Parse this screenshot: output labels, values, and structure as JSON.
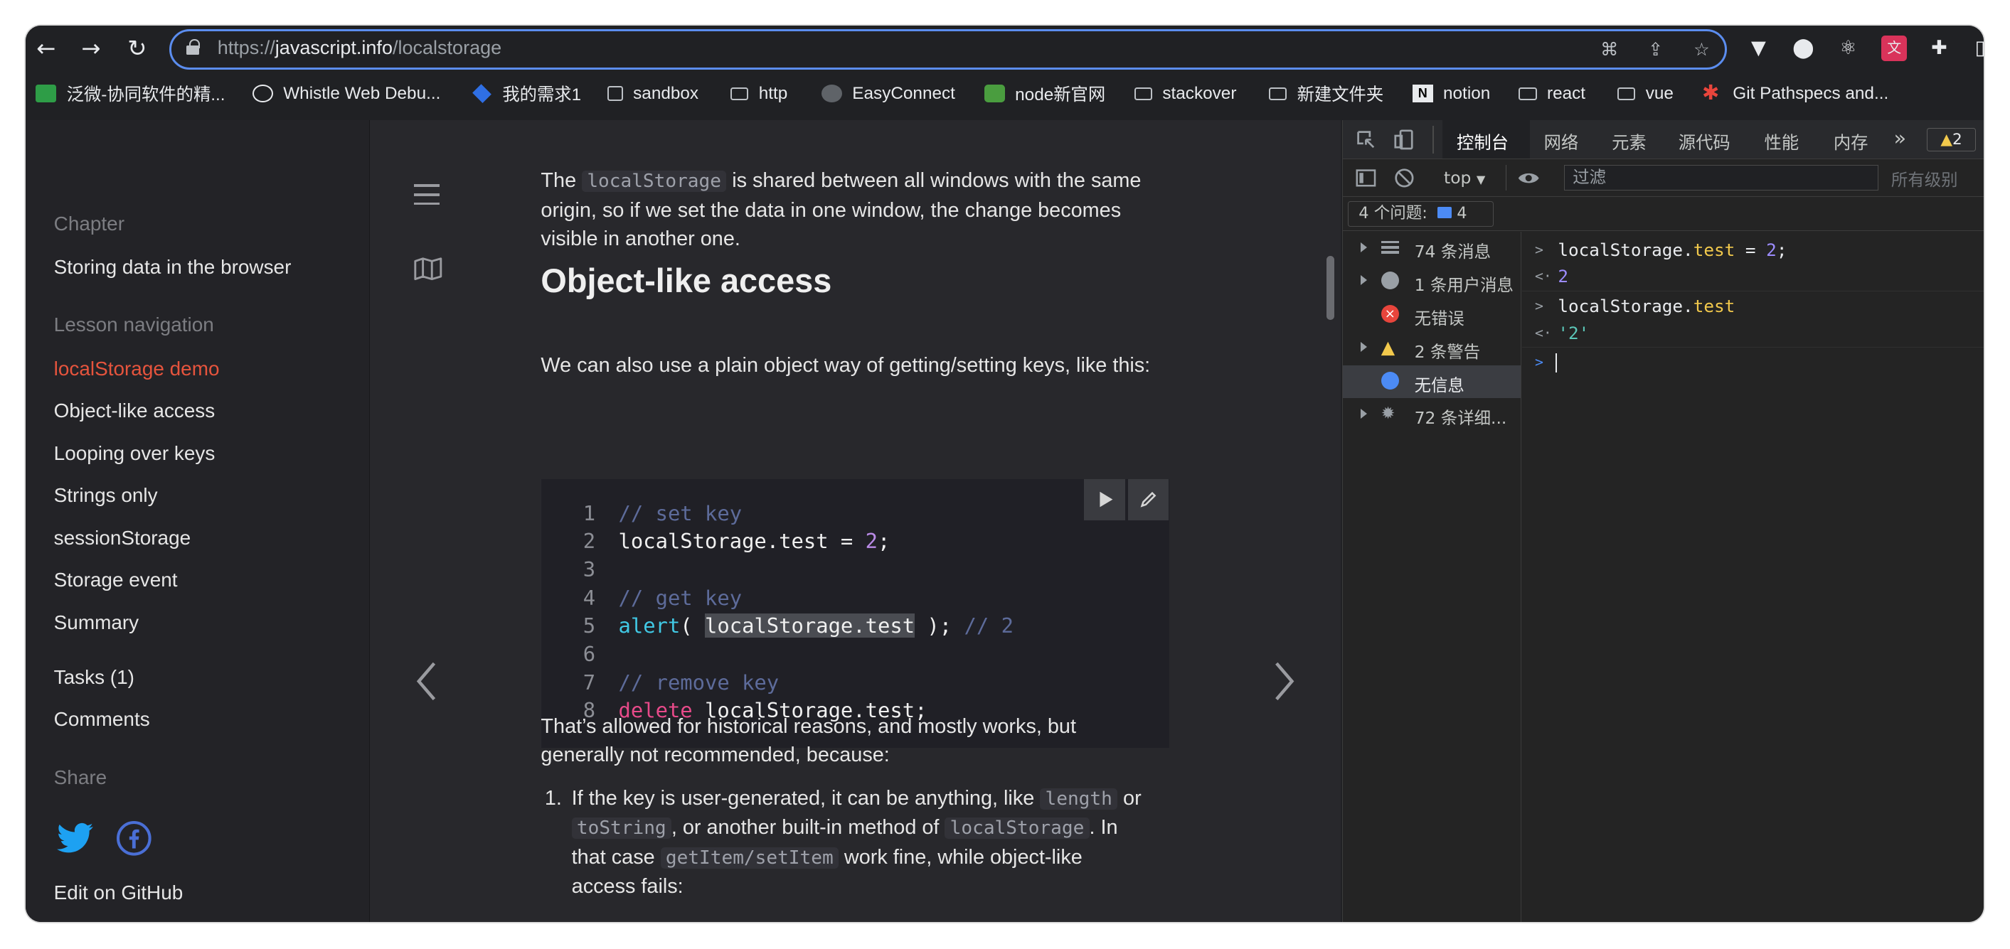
{
  "browser": {
    "url_prefix": "https://",
    "url_host": "javascript.info",
    "url_path": "/localstorage"
  },
  "bookmarks": [
    {
      "label": "泛微-协同软件的精...",
      "icon": "fanwei-logo-icon"
    },
    {
      "label": "Whistle Web Debu...",
      "icon": "whistle-logo-icon"
    },
    {
      "label": "我的需求1",
      "icon": "jira-logo-icon"
    },
    {
      "label": "sandbox",
      "icon": "page-icon"
    },
    {
      "label": "http",
      "icon": "folder-icon"
    },
    {
      "label": "EasyConnect",
      "icon": "globe-icon"
    },
    {
      "label": "node新官网",
      "icon": "node-logo-icon"
    },
    {
      "label": "stackover",
      "icon": "folder-icon"
    },
    {
      "label": "新建文件夹",
      "icon": "folder-icon"
    },
    {
      "label": "notion",
      "icon": "notion-logo-icon"
    },
    {
      "label": "react",
      "icon": "folder-icon"
    },
    {
      "label": "vue",
      "icon": "folder-icon"
    },
    {
      "label": "Git Pathspecs and...",
      "icon": "git-star-icon"
    }
  ],
  "sidebar": {
    "chapter_label": "Chapter",
    "chapter_title": "Storing data in the browser",
    "lesson_nav_label": "Lesson navigation",
    "lessons": [
      "localStorage demo",
      "Object-like access",
      "Looping over keys",
      "Strings only",
      "sessionStorage",
      "Storage event",
      "Summary"
    ],
    "tasks": "Tasks (1)",
    "comments": "Comments",
    "share_label": "Share",
    "edit": "Edit on GitHub"
  },
  "article": {
    "p1_a": "The",
    "p1_code": "localStorage",
    "p1_b": "is shared between all windows with the same",
    "p1_c": "origin, so if we set the data in one window, the change becomes",
    "p1_d": "visible in another one.",
    "heading": "Object-like access",
    "p2": "We can also use a plain object way of getting/setting keys, like this:",
    "code": {
      "l1_cm": "// set key",
      "l2_obj": "localStorage.test = ",
      "l2_num": "2",
      "l2_end": ";",
      "l4_cm": "// get key",
      "l5_fn": "alert",
      "l5_open": "( ",
      "l5_hl": "localStorage.test",
      "l5_close": " ); ",
      "l5_cm": "// 2",
      "l7_cm": "// remove key",
      "l8_kw": "delete",
      "l8_rest": " localStorage.test;",
      "line_numbers": [
        "1",
        "2",
        "3",
        "4",
        "5",
        "6",
        "7",
        "8"
      ]
    },
    "p3_a": "That’s allowed for historical reasons, and mostly works, but",
    "p3_b": "generally not recommended, because:",
    "li_num": "1.",
    "li_a": "If the key is user-generated, it can be anything, like",
    "li_code1": "length",
    "li_b": "or",
    "li_code2": "toString",
    "li_c": ", or another built-in method of",
    "li_code3": "localStorage",
    "li_d": ". In",
    "li_e": "that case",
    "li_code4": "getItem/setItem",
    "li_f": "work fine, while object-like",
    "li_g": "access fails:"
  },
  "devtools": {
    "tabs": [
      "控制台",
      "网络",
      "元素",
      "源代码",
      "性能",
      "内存"
    ],
    "warn_count": "2",
    "context": "top",
    "filter_placeholder": "过滤",
    "levels": "所有级别",
    "issues_label": "4 个问题:",
    "issues_count": "4",
    "sidebar": [
      {
        "label": "74 条消息",
        "icon": "list-icon"
      },
      {
        "label": "1 条用户消息",
        "icon": "user-icon"
      },
      {
        "label": "无错误",
        "icon": "error-icon"
      },
      {
        "label": "2 条警告",
        "icon": "warning-icon"
      },
      {
        "label": "无信息",
        "icon": "info-icon"
      },
      {
        "label": "72 条详细...",
        "icon": "bug-icon"
      }
    ],
    "console": {
      "in1_obj": "localStorage.",
      "in1_prop": "test",
      "in1_eq": " = ",
      "in1_num": "2",
      "in1_end": ";",
      "out1": "2",
      "in2_obj": "localStorage.",
      "in2_prop": "test",
      "out2": "'2'"
    }
  },
  "colors": {
    "accent_active": "#e6543d",
    "omnibox_border": "#5b8def"
  }
}
